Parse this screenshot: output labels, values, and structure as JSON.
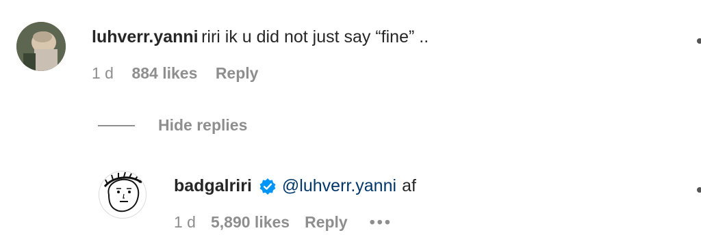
{
  "comment": {
    "username": "luhverr.yanni",
    "text": "riri ik u did not just say “fine” ..",
    "time": "1 d",
    "likes": "884 likes",
    "reply_label": "Reply"
  },
  "replies_toggle": {
    "label": "Hide replies"
  },
  "reply": {
    "username": "badgalriri",
    "mention": "@luhverr.yanni",
    "text": "af",
    "time": "1 d",
    "likes": "5,890 likes",
    "reply_label": "Reply",
    "more_label": "•••"
  },
  "icons": {
    "verified": "verified-badge-icon",
    "more": "more-options-icon"
  },
  "colors": {
    "text": "#262626",
    "meta": "#8e8e8e",
    "mention": "#00376b",
    "verified": "#0095f6"
  }
}
